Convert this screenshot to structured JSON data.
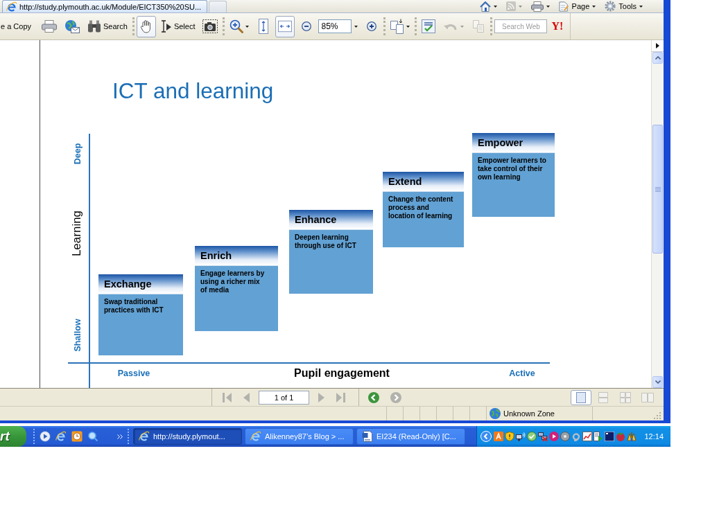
{
  "browser": {
    "tab": {
      "title": "http://study.plymouth.ac.uk/Module/EICT350%20SU..."
    },
    "command_bar": [
      {
        "kind": "home",
        "disabled": false
      },
      {
        "kind": "feeds",
        "disabled": true
      },
      {
        "kind": "print",
        "disabled": false
      },
      {
        "kind": "page",
        "label": "Page",
        "disabled": false
      },
      {
        "kind": "tools",
        "label": "Tools",
        "disabled": false
      }
    ]
  },
  "pdf_toolbar": {
    "groups": [
      [
        {
          "kind": "save-copy",
          "label": "e a Copy"
        },
        {
          "kind": "print"
        },
        {
          "kind": "email"
        },
        {
          "kind": "search",
          "label": "Search"
        }
      ],
      [
        {
          "kind": "hand",
          "selected": true
        },
        {
          "kind": "select",
          "label": "Select",
          "selected": false
        },
        {
          "kind": "snapshot",
          "selected": false
        }
      ],
      [
        {
          "kind": "zoom-in-menu"
        },
        {
          "kind": "fit-page",
          "selected": false
        },
        {
          "kind": "fit-width",
          "selected": true
        },
        {
          "kind": "zoom-out"
        },
        {
          "kind": "zoom-field",
          "value": "85%"
        },
        {
          "kind": "zoom-in"
        }
      ],
      [
        {
          "kind": "pages-menu"
        }
      ],
      [
        {
          "kind": "spell-check",
          "disabled": false
        },
        {
          "kind": "undo-menu",
          "disabled": true
        },
        {
          "kind": "copy",
          "disabled": true
        }
      ],
      [
        {
          "kind": "search-web",
          "placeholder": "Search Web"
        },
        {
          "kind": "yahoo",
          "label": "Y!"
        }
      ]
    ]
  },
  "slide": {
    "title": "ICT and learning",
    "y_axis": {
      "title": "Learning",
      "low": "Shallow",
      "high": "Deep"
    },
    "x_axis": {
      "title": "Pupil engagement",
      "low": "Passive",
      "high": "Active"
    },
    "stages": [
      {
        "title": "Exchange",
        "text": "Swap traditional practices with ICT"
      },
      {
        "title": "Enrich",
        "text": "Engage learners by using a richer mix of media"
      },
      {
        "title": "Enhance",
        "text": "Deepen learning through use of ICT"
      },
      {
        "title": "Extend",
        "text": "Change the content process and location of learning"
      },
      {
        "title": "Empower",
        "text": "Empower learners to take control of their own learning"
      }
    ]
  },
  "page_nav": {
    "buttons": [
      {
        "kind": "first",
        "disabled": true
      },
      {
        "kind": "previous",
        "disabled": true
      },
      {
        "kind": "page-field",
        "value": "1 of 1"
      },
      {
        "kind": "next",
        "disabled": true
      },
      {
        "kind": "last",
        "disabled": true
      },
      {
        "kind": "back",
        "disabled": false
      },
      {
        "kind": "forward",
        "disabled": true
      }
    ],
    "layouts": [
      {
        "kind": "single",
        "selected": true
      },
      {
        "kind": "continuous",
        "selected": false
      },
      {
        "kind": "continuous-facing",
        "selected": false
      },
      {
        "kind": "facing",
        "selected": false
      }
    ]
  },
  "status_bar": {
    "zone": "Unknown Zone"
  },
  "taskbar": {
    "start_label": "rt",
    "tasks": [
      {
        "kind": "ie",
        "label": "http://study.plymout...",
        "selected": true
      },
      {
        "kind": "ie",
        "label": "Alikenney87’s Blog > ...",
        "selected": false
      },
      {
        "kind": "word",
        "label": "EI234 (Read-Only) [C...",
        "selected": false
      }
    ],
    "clock": "12:14"
  }
}
